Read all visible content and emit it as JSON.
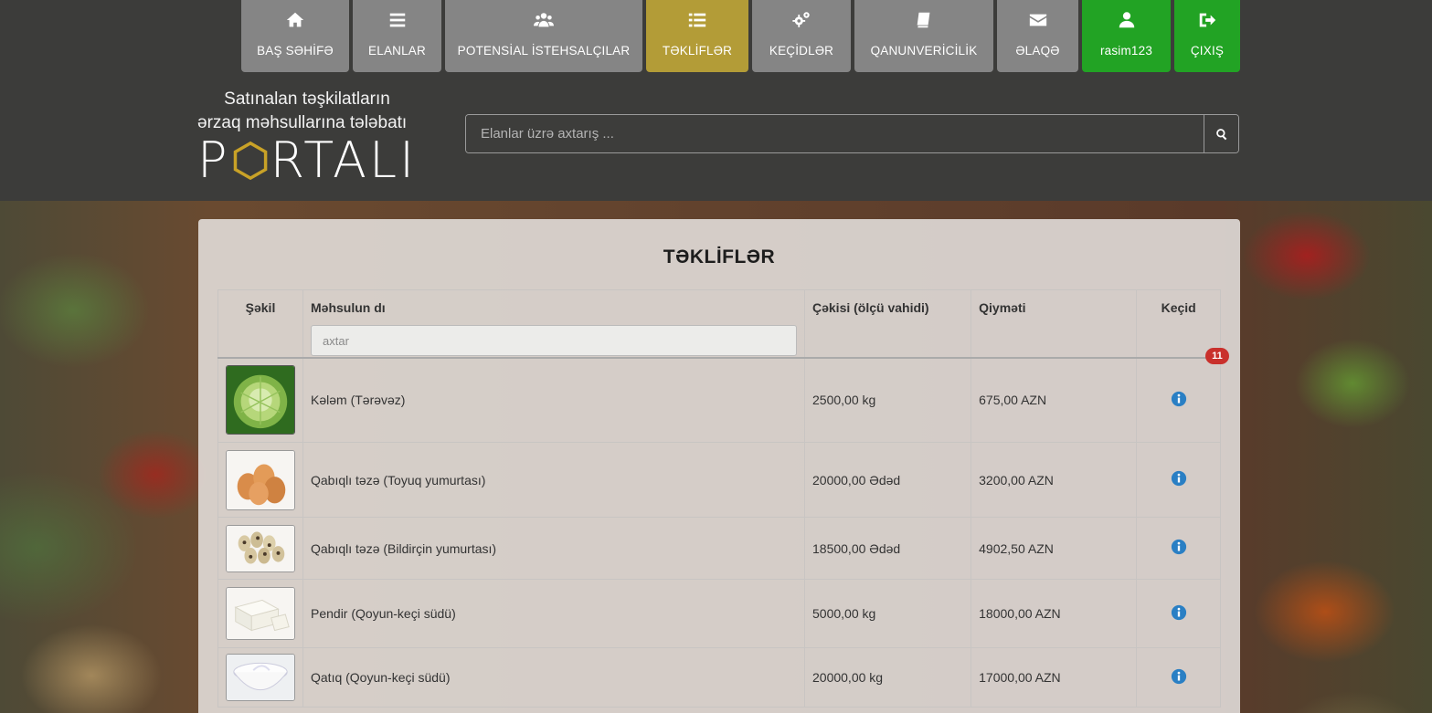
{
  "nav": {
    "items": [
      {
        "label": "BAŞ SƏHİFƏ",
        "icon": "home-icon"
      },
      {
        "label": "ELANLAR",
        "icon": "menu-icon"
      },
      {
        "label": "POTENSİAL İSTEHSALÇILAR",
        "icon": "users-icon"
      },
      {
        "label": "TƏKLİFLƏR",
        "icon": "list-icon"
      },
      {
        "label": "KEÇİDLƏR",
        "icon": "gears-icon"
      },
      {
        "label": "QANUNVERİCİLİK",
        "icon": "book-icon"
      },
      {
        "label": "ƏLAQƏ",
        "icon": "envelope-icon"
      },
      {
        "label": "rasim123",
        "icon": "user-icon"
      },
      {
        "label": "ÇIXIŞ",
        "icon": "sign-out-icon"
      }
    ],
    "active_index": 3
  },
  "logo": {
    "line1": "Satınalan təşkilatların",
    "line2": "ərzaq məhsullarına tələbatı",
    "big_left": "P",
    "big_right": "RTALI"
  },
  "search": {
    "placeholder": "Elanlar üzrə axtarış ..."
  },
  "main": {
    "title": "TƏKLİFLƏR",
    "columns": {
      "image": "Şəkil",
      "product": "Məhsulun dı",
      "weight": "Çəkisi (ölçü vahidi)",
      "price": "Qiymәti",
      "link": "Keçid"
    },
    "filter_placeholder": "axtar",
    "badge": "11",
    "rows": [
      {
        "product": "Kələm (Tərəvəz)",
        "weight": "2500,00 kg",
        "price": "675,00 AZN",
        "thumb": "cabbage"
      },
      {
        "product": "Qabıqlı təzə (Toyuq yumurtası)",
        "weight": "20000,00 Ədəd",
        "price": "3200,00 AZN",
        "thumb": "eggs"
      },
      {
        "product": "Qabıqlı təzə (Bildirçin yumurtası)",
        "weight": "18500,00 Ədəd",
        "price": "4902,50 AZN",
        "thumb": "quail-eggs"
      },
      {
        "product": "Pendir (Qoyun-keçi südü)",
        "weight": "5000,00 kg",
        "price": "18000,00 AZN",
        "thumb": "cheese"
      },
      {
        "product": "Qatıq (Qoyun-keçi südü)",
        "weight": "20000,00 kg",
        "price": "17000,00 AZN",
        "thumb": "yogurt"
      }
    ]
  },
  "colors": {
    "nav_default": "#858585",
    "nav_active": "#b39c37",
    "nav_user": "#22a324",
    "info_icon": "#2a7fc4",
    "badge": "#c9302c"
  }
}
